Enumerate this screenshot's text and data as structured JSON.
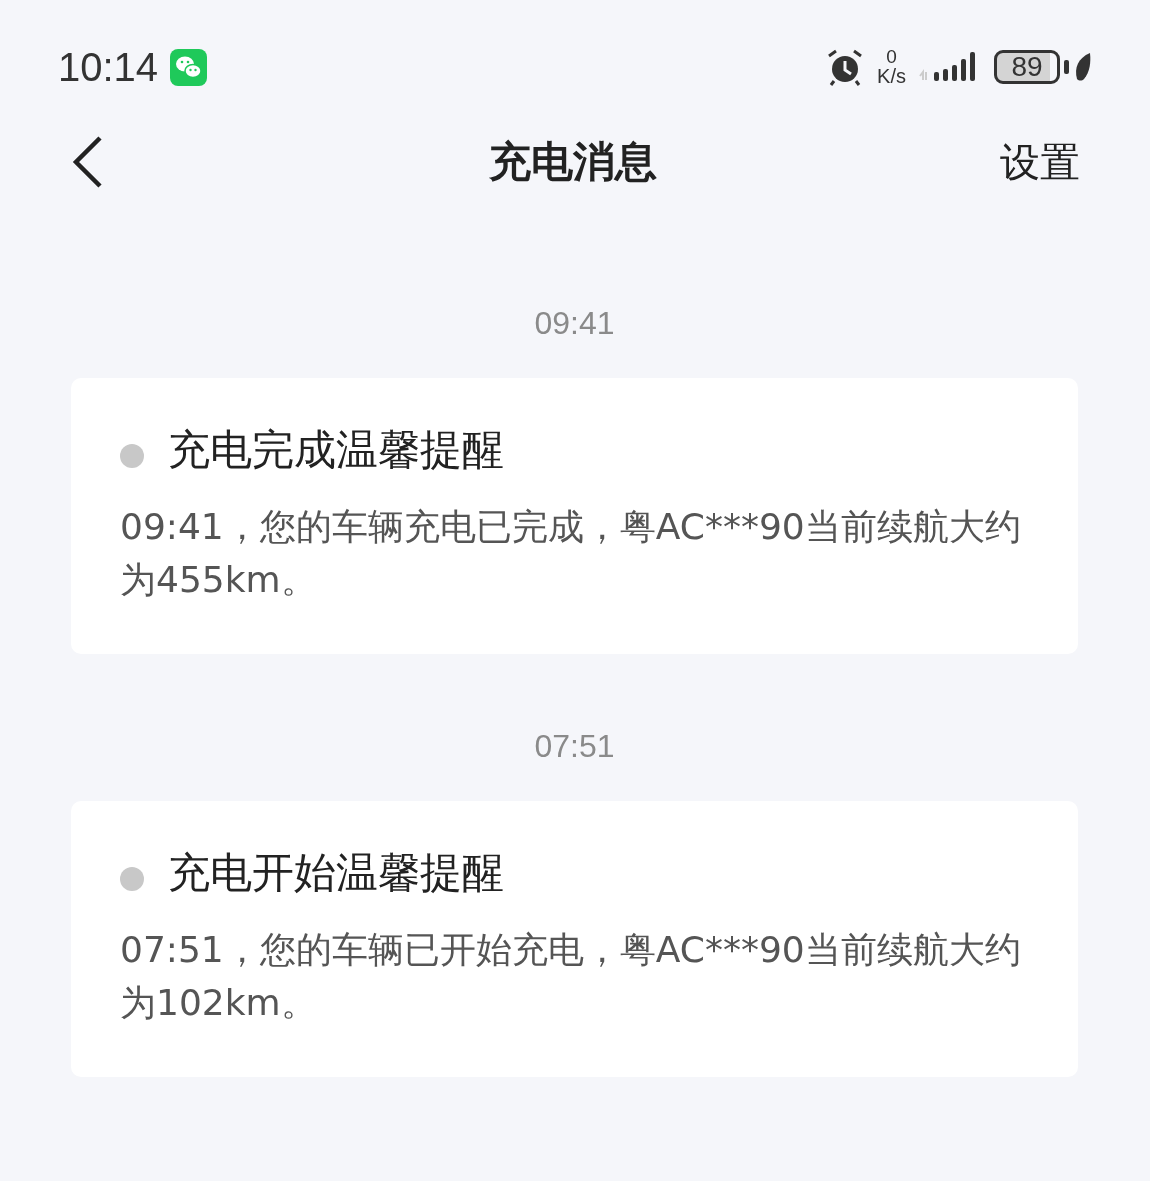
{
  "status_bar": {
    "time": "10:14",
    "speed_value": "0",
    "speed_unit": "K/s",
    "battery": "89"
  },
  "header": {
    "title": "充电消息",
    "action": "设置"
  },
  "messages": [
    {
      "time": "09:41",
      "title": "充电完成温馨提醒",
      "body": "09:41，您的车辆充电已完成，粤AC***90当前续航大约为455km。"
    },
    {
      "time": "07:51",
      "title": "充电开始温馨提醒",
      "body": "07:51，您的车辆已开始充电，粤AC***90当前续航大约为102km。"
    }
  ]
}
